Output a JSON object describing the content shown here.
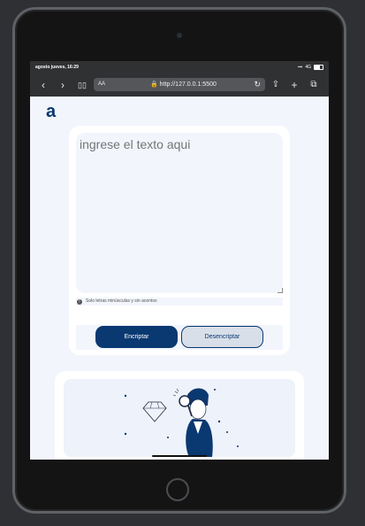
{
  "status_bar": {
    "time": "agosto jueves, 16:29",
    "network": "4G"
  },
  "browser": {
    "text_size_label": "AA",
    "url": "http://127.0.0.1:5500"
  },
  "app": {
    "logo": "a",
    "input_placeholder": "ingrese el texto aqui",
    "hint": "Solo letras minúsculas y sin acentos",
    "encrypt_label": "Encriptar",
    "decrypt_label": "Desencriptar"
  },
  "colors": {
    "primary": "#0a3871",
    "background": "#f2f5fc",
    "secondary_button": "#d8dfe8"
  },
  "icons": [
    "back-icon",
    "forward-icon",
    "book-icon",
    "lock-icon",
    "reload-icon",
    "share-icon",
    "add-tab-icon",
    "tabs-icon",
    "info-icon",
    "search-illustration"
  ]
}
